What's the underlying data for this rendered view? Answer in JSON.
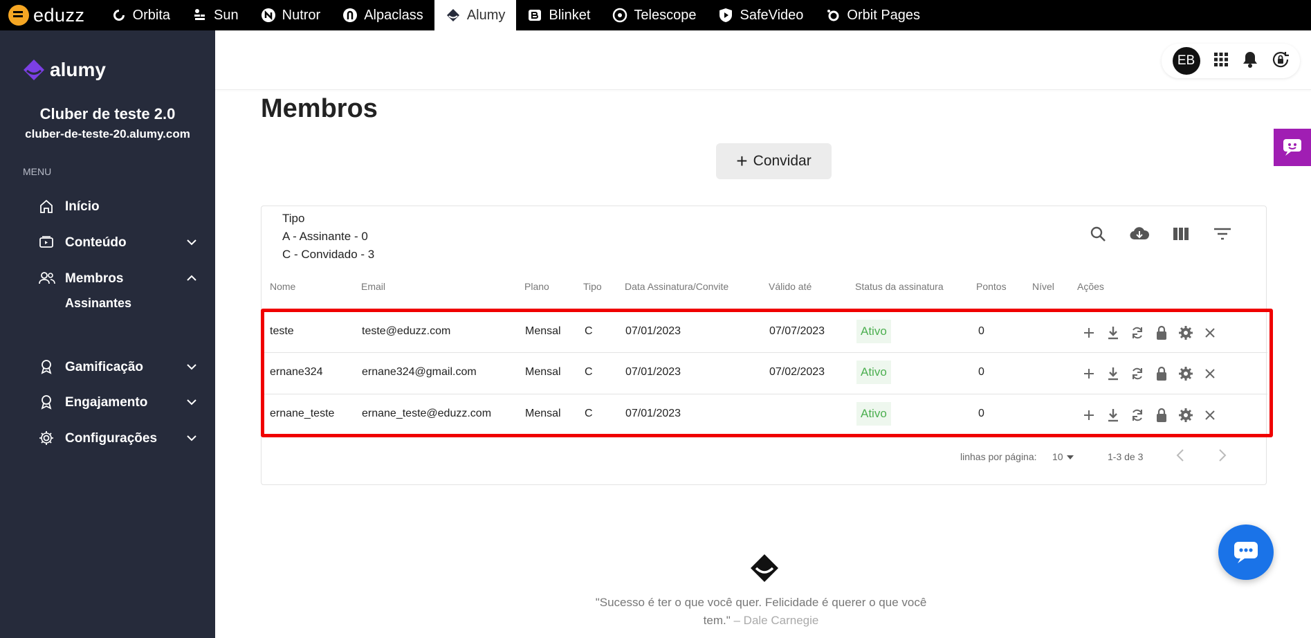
{
  "topbar": {
    "brand": "eduzz",
    "apps": [
      {
        "label": "Orbita",
        "icon": "orbita-icon"
      },
      {
        "label": "Sun",
        "icon": "sun-icon"
      },
      {
        "label": "Nutror",
        "icon": "nutror-icon"
      },
      {
        "label": "Alpaclass",
        "icon": "alpaclass-icon"
      },
      {
        "label": "Alumy",
        "icon": "alumy-icon",
        "active": true
      },
      {
        "label": "Blinket",
        "icon": "blinket-icon"
      },
      {
        "label": "Telescope",
        "icon": "telescope-icon"
      },
      {
        "label": "SafeVideo",
        "icon": "safevideo-icon"
      },
      {
        "label": "Orbit Pages",
        "icon": "orbit-pages-icon"
      }
    ]
  },
  "sidebar": {
    "logo": "alumy",
    "club_name": "Cluber de teste 2.0",
    "club_url": "cluber-de-teste-20.alumy.com",
    "menu_label": "MENU",
    "items": [
      {
        "label": "Início",
        "icon": "home-icon"
      },
      {
        "label": "Conteúdo",
        "icon": "content-icon",
        "chevron": "down"
      },
      {
        "label": "Membros",
        "icon": "members-icon",
        "chevron": "up"
      },
      {
        "label": "Gamificação",
        "icon": "medal-icon",
        "chevron": "down"
      },
      {
        "label": "Engajamento",
        "icon": "medal-icon",
        "chevron": "down"
      },
      {
        "label": "Configurações",
        "icon": "gear-icon",
        "chevron": "down"
      }
    ],
    "sub_item": "Assinantes"
  },
  "header": {
    "avatar": "EB",
    "icons": [
      "apps-grid-icon",
      "bell-icon",
      "logout-icon"
    ]
  },
  "main": {
    "title": "Membros",
    "invite_label": "Convidar",
    "legend": {
      "title": "Tipo",
      "line_a": "A - Assinante - 0",
      "line_c": "C - Convidado - 3"
    },
    "toolbar_icons": [
      "search-icon",
      "cloud-download-icon",
      "columns-icon",
      "filter-icon"
    ],
    "columns": {
      "nome": "Nome",
      "email": "Email",
      "plano": "Plano",
      "tipo": "Tipo",
      "data": "Data Assinatura/Convite",
      "valido": "Válido até",
      "status": "Status da assinatura",
      "pontos": "Pontos",
      "nivel": "Nível",
      "acoes": "Ações"
    },
    "rows": [
      {
        "nome": "teste",
        "email": "teste@eduzz.com",
        "plano": "Mensal",
        "tipo": "C",
        "data": "07/01/2023",
        "valido": "07/07/2023",
        "status": "Ativo",
        "pontos": "0"
      },
      {
        "nome": "ernane324",
        "email": "ernane324@gmail.com",
        "plano": "Mensal",
        "tipo": "C",
        "data": "07/01/2023",
        "valido": "07/02/2023",
        "status": "Ativo",
        "pontos": "0"
      },
      {
        "nome": "ernane_teste",
        "email": "ernane_teste@eduzz.com",
        "plano": "Mensal",
        "tipo": "C",
        "data": "07/01/2023",
        "valido": "",
        "status": "Ativo",
        "pontos": "0"
      }
    ],
    "row_action_icons": [
      "plus-icon",
      "download-icon",
      "refresh-icon",
      "lock-icon",
      "gear-icon",
      "close-icon"
    ],
    "pagination": {
      "rows_label": "linhas por página:",
      "rows_value": "10",
      "range": "1-3 de 3"
    }
  },
  "footer": {
    "quote": "\"Sucesso é ter o que você quer. Felicidade é querer o que você tem.\"",
    "author": "– Dale Carnegie"
  },
  "colors": {
    "topbar": "#000000",
    "sidebar": "#262b3b",
    "status_green": "#4caf50",
    "highlight": "#f00000",
    "chat_fab": "#1a73e8",
    "side_tab": "#a01eb3"
  }
}
